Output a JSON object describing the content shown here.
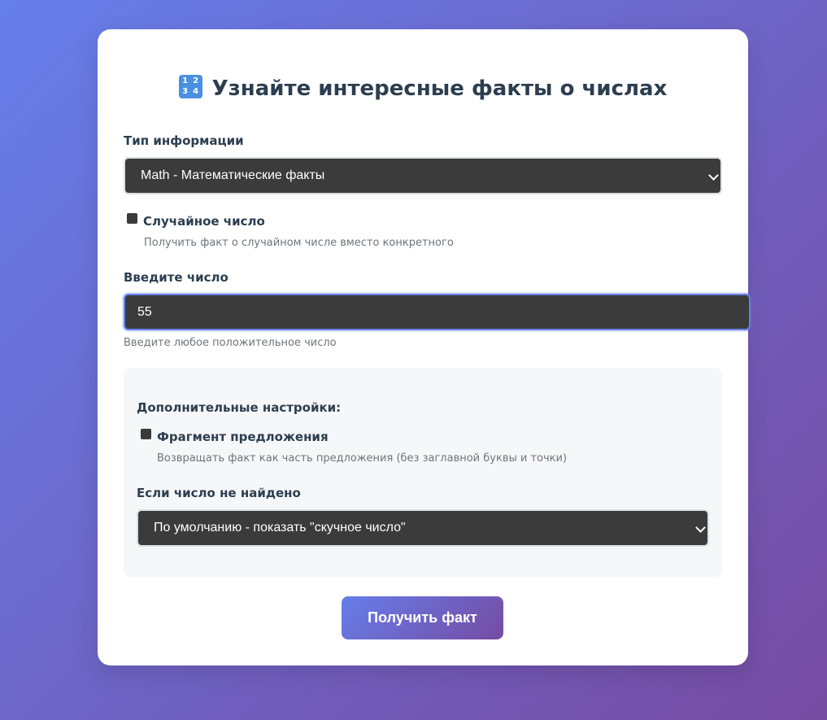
{
  "title": "Узнайте интересные факты о числах",
  "title_icon": "input-numbers-icon",
  "type_section": {
    "label": "Тип информации",
    "selected": "Math - Математические факты"
  },
  "random": {
    "label": "Случайное число",
    "hint": "Получить факт о случайном числе вместо конкретного",
    "checked": false
  },
  "number": {
    "label": "Введите число",
    "value": "55",
    "hint": "Введите любое положительное число"
  },
  "advanced": {
    "heading": "Дополнительные настройки:",
    "fragment": {
      "label": "Фрагмент предложения",
      "hint": "Возвращать факт как часть предложения (без заглавной буквы и точки)",
      "checked": false
    },
    "not_found": {
      "label": "Если число не найдено",
      "selected": "По умолчанию - показать \"скучное число\""
    }
  },
  "submit_label": "Получить факт",
  "colors": {
    "gradient_start": "#667eea",
    "gradient_end": "#764ba2",
    "text_dark": "#2c3e50",
    "field_bg": "#3b3b3b"
  }
}
